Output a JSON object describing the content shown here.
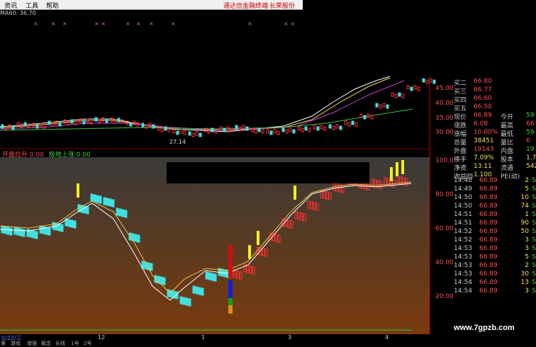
{
  "menu": {
    "items": [
      "资讯",
      "工具",
      "帮助"
    ],
    "title": "通达信金融终端",
    "sub": "长荣股份"
  },
  "ma_header": "MA60: 36.70",
  "indicator": {
    "name": "开盘拉升",
    "v1": "0.00",
    "name2": "极地上涨",
    "v2": "0.00"
  },
  "price_axis": [
    "45.00",
    "40.00",
    "35.00",
    "30.00"
  ],
  "ind_axis": [
    "100.0",
    "80.00",
    "60.00",
    "40.00",
    "20.00"
  ],
  "low_label": "27.14",
  "quote": [
    {
      "l": "买二",
      "v": "66.80",
      "vc": "red"
    },
    {
      "l": "买三",
      "v": "66.77",
      "vc": "red"
    },
    {
      "l": "买四",
      "v": "66.60",
      "vc": "red"
    },
    {
      "l": "买五",
      "v": "66.50",
      "vc": "red"
    },
    {
      "l": "现价",
      "v": "66.89",
      "vc": "red",
      "l2": "今开",
      "v2": "59",
      "v2c": "grn"
    },
    {
      "l": "涨跌",
      "v": "6.08",
      "vc": "red",
      "l2": "最高",
      "v2": "66",
      "v2c": "red"
    },
    {
      "l": "涨幅",
      "v": "10.00%",
      "vc": "red",
      "l2": "最低",
      "v2": "59",
      "v2c": "grn"
    },
    {
      "l": "总量",
      "v": "38451",
      "vc": "yel",
      "l2": "量比",
      "v2": "6",
      "v2c": "red"
    },
    {
      "l": "外盘",
      "v": "19143",
      "vc": "red",
      "l2": "内盘",
      "v2": "19",
      "v2c": "grn"
    },
    {
      "l": "换手",
      "v": "7.09%",
      "vc": "yel",
      "l2": "股本",
      "v2": "1.7",
      "v2c": "yel"
    },
    {
      "l": "净资",
      "v": "13.11",
      "vc": "yel",
      "l2": "流通",
      "v2": "542",
      "v2c": "yel"
    },
    {
      "l": "收益㈣",
      "v": "1.100",
      "vc": "yel",
      "l2": "PE(动)",
      "v2": "",
      "v2c": "yel"
    }
  ],
  "ticks": [
    {
      "t": "14:48",
      "p": "66.89",
      "n": "2",
      "s": "S"
    },
    {
      "t": "14:49",
      "p": "66.89",
      "n": "5",
      "s": "S"
    },
    {
      "t": "14:50",
      "p": "66.89",
      "n": "10",
      "s": "S"
    },
    {
      "t": "14:50",
      "p": "66.89",
      "n": "74",
      "s": "S"
    },
    {
      "t": "14:51",
      "p": "66.89",
      "n": "1",
      "s": "S"
    },
    {
      "t": "14:51",
      "p": "66.89",
      "n": "90",
      "s": "S"
    },
    {
      "t": "14:52",
      "p": "66.89",
      "n": "50",
      "s": "S"
    },
    {
      "t": "14:52",
      "p": "66.89",
      "n": "3",
      "s": "S"
    },
    {
      "t": "14:53",
      "p": "66.89",
      "n": "3",
      "s": "S"
    },
    {
      "t": "14:53",
      "p": "66.89",
      "n": "5",
      "s": "S"
    },
    {
      "t": "14:53",
      "p": "66.89",
      "n": "2",
      "s": "S"
    },
    {
      "t": "14:53",
      "p": "66.89",
      "n": "30",
      "s": "S"
    },
    {
      "t": "14:54",
      "p": "66.89",
      "n": "13",
      "s": "S"
    },
    {
      "t": "14:54",
      "p": "66.89",
      "n": "3",
      "s": "S"
    }
  ],
  "xaxis": [
    "0/22/三",
    "12",
    "1",
    "3",
    "4"
  ],
  "bottombar": [
    "第",
    "游戏",
    "增强",
    "概念",
    "板块",
    "长线",
    "1号",
    "2号"
  ],
  "watermark": "www.7gpzb.com",
  "colors": {
    "up": "#ff3030",
    "down": "#40e0e0",
    "gradient_top": "#404040",
    "gradient_bottom": "#7a3a10"
  }
}
